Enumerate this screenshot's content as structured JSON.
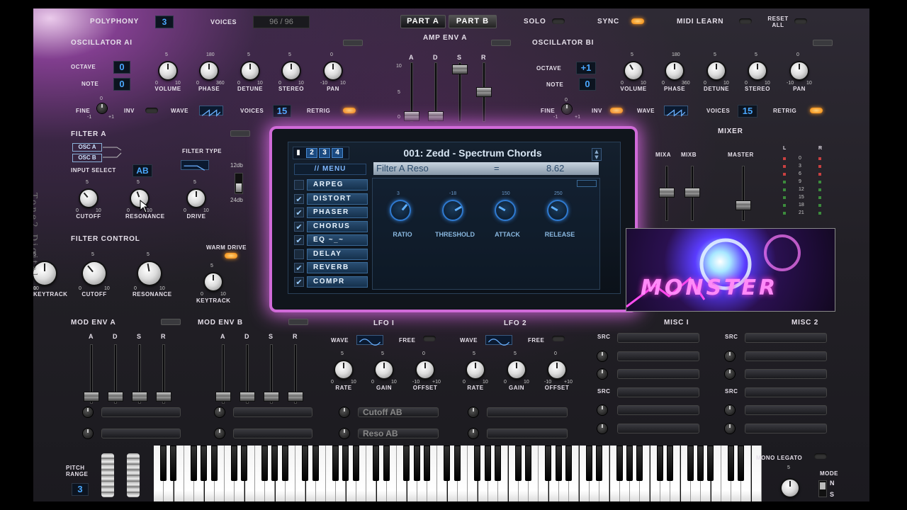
{
  "header": {
    "polyphony_label": "POLYPHONY",
    "polyphony_value": "3",
    "voices_label": "VOICES",
    "voices_value": "96 / 96",
    "part_a": "PART A",
    "part_b": "PART B",
    "solo_label": "SOLO",
    "sync_label": "SYNC",
    "midi_learn_label": "MIDI LEARN",
    "reset_all_label": "RESET ALL"
  },
  "osc_a": {
    "title": "OSCILLATOR AI",
    "octave_label": "OCTAVE",
    "octave_value": "0",
    "note_label": "NOTE",
    "note_value": "0",
    "fine_label": "FINE",
    "fine_min": "-1",
    "fine_max": "+1",
    "fine_zero": "0",
    "inv_label": "INV",
    "wave_label": "WAVE",
    "voices_label": "VOICES",
    "voices_value": "15",
    "retrig_label": "RETRIG",
    "knobs": [
      {
        "label": "VOLUME",
        "top": "5",
        "min": "0",
        "max": "10"
      },
      {
        "label": "PHASE",
        "top": "180",
        "min": "0",
        "max": "360"
      },
      {
        "label": "DETUNE",
        "top": "5",
        "min": "0",
        "max": "10"
      },
      {
        "label": "STEREO",
        "top": "5",
        "min": "0",
        "max": "10"
      },
      {
        "label": "PAN",
        "top": "0",
        "min": "-10",
        "max": "10"
      }
    ]
  },
  "osc_b": {
    "title": "OSCILLATOR BI",
    "octave_label": "OCTAVE",
    "octave_value": "+1",
    "note_label": "NOTE",
    "note_value": "0",
    "fine_label": "FINE",
    "fine_min": "-1",
    "fine_max": "+1",
    "fine_zero": "0",
    "inv_label": "INV",
    "wave_label": "WAVE",
    "voices_label": "VOICES",
    "voices_value": "15",
    "retrig_label": "RETRIG",
    "knobs": [
      {
        "label": "VOLUME",
        "top": "5",
        "min": "0",
        "max": "10"
      },
      {
        "label": "PHASE",
        "top": "180",
        "min": "0",
        "max": "360"
      },
      {
        "label": "DETUNE",
        "top": "5",
        "min": "0",
        "max": "10"
      },
      {
        "label": "STEREO",
        "top": "5",
        "min": "0",
        "max": "10"
      },
      {
        "label": "PAN",
        "top": "0",
        "min": "-10",
        "max": "10"
      }
    ]
  },
  "amp_env": {
    "title": "AMP ENV A",
    "a": "A",
    "d": "D",
    "s": "S",
    "r": "R",
    "s10": "10",
    "s5": "5",
    "s0": "0"
  },
  "filter_a": {
    "title": "FILTER A",
    "osc_a": "OSC A",
    "osc_b": "OSC B",
    "input_select_label": "INPUT SELECT",
    "input_select_value": "AB",
    "filter_type_label": "FILTER TYPE",
    "db12": "12db",
    "db24": "24db",
    "knobs": [
      {
        "label": "CUTOFF",
        "top": "5",
        "min": "0",
        "max": "10"
      },
      {
        "label": "RESONANCE",
        "top": "5",
        "min": "0",
        "max": "10"
      },
      {
        "label": "DRIVE",
        "top": "5",
        "min": "0",
        "max": "10"
      }
    ]
  },
  "filter_control": {
    "title": "FILTER CONTROL",
    "warm_drive_label": "WARM DRIVE",
    "knobs": [
      {
        "label": "CUTOFF",
        "top": "5",
        "min": "0",
        "max": "10"
      },
      {
        "label": "RESONANCE",
        "top": "5",
        "min": "0",
        "max": "10"
      },
      {
        "label": "KEYTRACK",
        "top": "5",
        "min": "0",
        "max": "10"
      }
    ]
  },
  "display": {
    "pages": [
      "1",
      "2",
      "3",
      "4"
    ],
    "preset_name": "001: Zedd - Spectrum Chords",
    "menu_label": "// MENU",
    "param_name": "Filter A Reso",
    "param_eq": "=",
    "param_value": "8.62",
    "effects": [
      {
        "name": "ARPEG",
        "checked": false
      },
      {
        "name": "DISTORT",
        "checked": true
      },
      {
        "name": "PHASER",
        "checked": true
      },
      {
        "name": "CHORUS",
        "checked": true
      },
      {
        "name": "EQ ~_~",
        "checked": true
      },
      {
        "name": "DELAY",
        "checked": false
      },
      {
        "name": "REVERB",
        "checked": true
      },
      {
        "name": "COMPR",
        "checked": true
      }
    ],
    "comp_knobs": [
      {
        "label": "RATIO",
        "top": "3"
      },
      {
        "label": "THRESHOLD",
        "top": "-18"
      },
      {
        "label": "ATTACK",
        "top": "150"
      },
      {
        "label": "RELEASE",
        "top": "250"
      }
    ]
  },
  "mixer": {
    "title": "MIXER",
    "mixa": "MIXA",
    "mixb": "MIXB",
    "master": "MASTER",
    "l": "L",
    "r": "R",
    "scale": [
      "0",
      "3",
      "6",
      "9",
      "12",
      "15",
      "18",
      "21"
    ]
  },
  "artwork": {
    "text": "MONSTER"
  },
  "branding": {
    "text": "Tone2 Digital"
  },
  "mod_env_a": {
    "title": "MOD ENV A",
    "a": "A",
    "d": "D",
    "s": "S",
    "r": "R"
  },
  "mod_env_b": {
    "title": "MOD ENV B",
    "a": "A",
    "d": "D",
    "s": "S",
    "r": "R"
  },
  "lfo1": {
    "title": "LFO I",
    "wave_label": "WAVE",
    "free_label": "FREE",
    "knobs": [
      {
        "label": "RATE",
        "top": "5",
        "min": "0",
        "max": "10"
      },
      {
        "label": "GAIN",
        "top": "5",
        "min": "0",
        "max": "10"
      },
      {
        "label": "OFFSET",
        "top": "0",
        "min": "-10",
        "max": "+10"
      }
    ],
    "dest1": "Cutoff AB",
    "dest2": "Reso AB"
  },
  "lfo2": {
    "title": "LFO 2",
    "wave_label": "WAVE",
    "free_label": "FREE",
    "knobs": [
      {
        "label": "RATE",
        "top": "5",
        "min": "0",
        "max": "10"
      },
      {
        "label": "GAIN",
        "top": "5",
        "min": "0",
        "max": "10"
      },
      {
        "label": "OFFSET",
        "top": "0",
        "min": "-10",
        "max": "+10"
      }
    ]
  },
  "misc1": {
    "title": "MISC I",
    "src": "SRC"
  },
  "misc2": {
    "title": "MISC 2",
    "src": "SRC"
  },
  "footer": {
    "pitch_range_label": "PITCH RANGE",
    "pitch_range_value": "3",
    "mono_legato_label": "MONO LEGATO",
    "mode_label": "MODE",
    "mode_n": "N",
    "mode_s": "S",
    "mode_knob_top": "5"
  },
  "colors": {
    "accent_orange": "#ff9a20",
    "lcd_blue": "#4aa8ff",
    "glow_pink": "#d06ad8"
  }
}
